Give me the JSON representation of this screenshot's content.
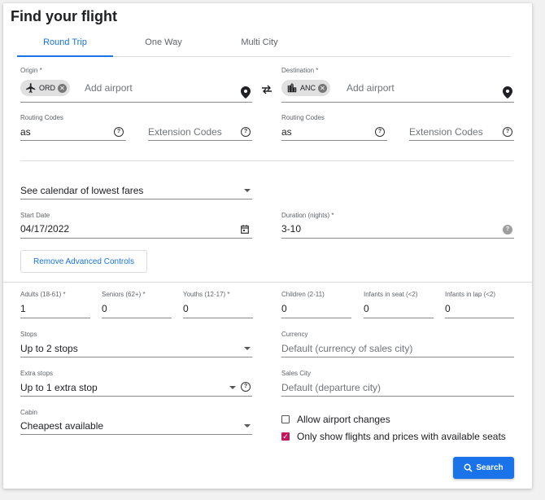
{
  "title": "Find your flight",
  "tabs": [
    {
      "label": "Round Trip"
    },
    {
      "label": "One Way"
    },
    {
      "label": "Multi City"
    }
  ],
  "origin": {
    "label": "Origin *",
    "chip": "ORD",
    "placeholder": "Add airport"
  },
  "destination": {
    "label": "Destination *",
    "chip": "ANC",
    "placeholder": "Add airport"
  },
  "routing_left": {
    "label": "Routing Codes",
    "value": "as",
    "ext_placeholder": "Extension Codes"
  },
  "routing_right": {
    "label": "Routing Codes",
    "value": "as",
    "ext_placeholder": "Extension Codes"
  },
  "calendar_select": "See calendar of lowest fares",
  "start_date": {
    "label": "Start Date",
    "value": "04/17/2022"
  },
  "duration": {
    "label": "Duration (nights) *",
    "value": "3-10"
  },
  "remove_advanced": "Remove Advanced Controls",
  "passengers": [
    {
      "label": "Adults (18-61) *",
      "value": "1"
    },
    {
      "label": "Seniors (62+) *",
      "value": "0"
    },
    {
      "label": "Youths (12-17) *",
      "value": "0"
    },
    {
      "label": "Children (2-11)",
      "value": "0"
    },
    {
      "label": "Infants in seat (<2)",
      "value": "0"
    },
    {
      "label": "Infants in lap (<2)",
      "value": "0"
    }
  ],
  "stops": {
    "label": "Stops",
    "value": "Up to 2 stops"
  },
  "currency": {
    "label": "Currency",
    "value": "Default (currency of sales city)"
  },
  "extra_stops": {
    "label": "Extra stops",
    "value": "Up to 1 extra stop"
  },
  "sales_city": {
    "label": "Sales City",
    "value": "Default (departure city)"
  },
  "cabin": {
    "label": "Cabin",
    "value": "Cheapest available"
  },
  "allow_airport_changes": {
    "label": "Allow airport changes",
    "checked": false
  },
  "only_show": {
    "label": "Only show flights and prices with available seats",
    "checked": true
  },
  "search_label": "Search",
  "colors": {
    "accent": "#1a73e8",
    "checkbox": "#c2185b"
  }
}
